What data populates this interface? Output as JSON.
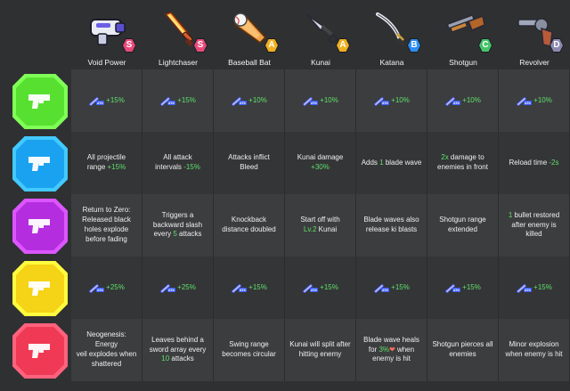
{
  "colors": {
    "background": "#2f3032",
    "highlight_green": "#5fe06a",
    "highlight_red": "#ff6a5a",
    "badge_green": "#57e02f",
    "badge_blue": "#1aa2f0",
    "badge_purple": "#b42ee0",
    "badge_yellow": "#f5d316",
    "badge_red": "#f03a55"
  },
  "weapons": [
    {
      "name": "Void Power",
      "grade": "S",
      "grade_color": "#e84a7a",
      "icon": "void-power-gun-icon"
    },
    {
      "name": "Lightchaser",
      "grade": "S",
      "grade_color": "#e84a7a",
      "icon": "lightchaser-sword-icon"
    },
    {
      "name": "Baseball Bat",
      "grade": "A",
      "grade_color": "#f0b020",
      "icon": "baseball-bat-icon"
    },
    {
      "name": "Kunai",
      "grade": "A",
      "grade_color": "#f0b020",
      "icon": "kunai-icon"
    },
    {
      "name": "Katana",
      "grade": "B",
      "grade_color": "#2c8ef0",
      "icon": "katana-icon"
    },
    {
      "name": "Shotgun",
      "grade": "C",
      "grade_color": "#46c46a",
      "icon": "shotgun-icon"
    },
    {
      "name": "Revolver",
      "grade": "D",
      "grade_color": "#8a8ab0",
      "icon": "revolver-icon"
    }
  ],
  "atk_label": "ATK",
  "rows": [
    {
      "badge_color": "#57e02f",
      "badge_icon": "gun-icon",
      "cells": [
        {
          "type": "atk",
          "value": "+15%"
        },
        {
          "type": "atk",
          "value": "+15%"
        },
        {
          "type": "atk",
          "value": "+10%"
        },
        {
          "type": "atk",
          "value": "+10%"
        },
        {
          "type": "atk",
          "value": "+10%"
        },
        {
          "type": "atk",
          "value": "+10%"
        },
        {
          "type": "atk",
          "value": "+10%"
        }
      ]
    },
    {
      "badge_color": "#1aa2f0",
      "badge_icon": "gun-icon",
      "cells": [
        {
          "type": "text",
          "parts": [
            {
              "t": "All projectile\nrange "
            },
            {
              "t": "+15%",
              "c": "green"
            }
          ]
        },
        {
          "type": "text",
          "parts": [
            {
              "t": "All attack\nintervals "
            },
            {
              "t": "-15%",
              "c": "green"
            }
          ]
        },
        {
          "type": "text",
          "parts": [
            {
              "t": "Attacks inflict\nBleed"
            }
          ]
        },
        {
          "type": "text",
          "parts": [
            {
              "t": "Kunai damage\n"
            },
            {
              "t": "+30%",
              "c": "green"
            }
          ]
        },
        {
          "type": "text",
          "parts": [
            {
              "t": "Adds "
            },
            {
              "t": "1",
              "c": "green"
            },
            {
              "t": " blade wave"
            }
          ]
        },
        {
          "type": "text",
          "parts": [
            {
              "t": "2x",
              "c": "green"
            },
            {
              "t": " damage to\nenemies in front"
            }
          ]
        },
        {
          "type": "text",
          "parts": [
            {
              "t": "Reload time "
            },
            {
              "t": "-2s",
              "c": "green"
            }
          ]
        }
      ]
    },
    {
      "badge_color": "#b42ee0",
      "badge_icon": "gun-icon",
      "cells": [
        {
          "type": "text",
          "parts": [
            {
              "t": "Return to Zero:\nReleased black\nholes explode\nbefore fading"
            }
          ]
        },
        {
          "type": "text",
          "parts": [
            {
              "t": "Triggers a\nbackward slash\nevery "
            },
            {
              "t": "5",
              "c": "green"
            },
            {
              "t": " attacks"
            }
          ]
        },
        {
          "type": "text",
          "parts": [
            {
              "t": "Knockback\ndistance doubled"
            }
          ]
        },
        {
          "type": "text",
          "parts": [
            {
              "t": "Start off with\n"
            },
            {
              "t": "Lv.2",
              "c": "green"
            },
            {
              "t": " Kunai"
            }
          ]
        },
        {
          "type": "text",
          "parts": [
            {
              "t": "Blade waves also\nrelease ki blasts"
            }
          ]
        },
        {
          "type": "text",
          "parts": [
            {
              "t": "Shotgun range\nextended"
            }
          ]
        },
        {
          "type": "text",
          "parts": [
            {
              "t": "1",
              "c": "green"
            },
            {
              "t": " bullet restored\nafter enemy is killed"
            }
          ]
        }
      ]
    },
    {
      "badge_color": "#f5d316",
      "badge_icon": "gun-icon",
      "cells": [
        {
          "type": "atk",
          "value": "+25%"
        },
        {
          "type": "atk",
          "value": "+25%"
        },
        {
          "type": "atk",
          "value": "+15%"
        },
        {
          "type": "atk",
          "value": "+15%"
        },
        {
          "type": "atk",
          "value": "+15%"
        },
        {
          "type": "atk",
          "value": "+15%"
        },
        {
          "type": "atk",
          "value": "+15%"
        }
      ]
    },
    {
      "badge_color": "#f03a55",
      "badge_icon": "gun-icon",
      "cells": [
        {
          "type": "text",
          "parts": [
            {
              "t": "Neogenesis: Energy\nveil explodes when\nshattered"
            }
          ]
        },
        {
          "type": "text",
          "parts": [
            {
              "t": "Leaves behind a\nsword array every\n"
            },
            {
              "t": "10",
              "c": "green"
            },
            {
              "t": " attacks"
            }
          ]
        },
        {
          "type": "text",
          "parts": [
            {
              "t": "Swing range\nbecomes circular"
            }
          ]
        },
        {
          "type": "text",
          "parts": [
            {
              "t": "Kunai will split after\nhitting enemy"
            }
          ]
        },
        {
          "type": "text",
          "parts": [
            {
              "t": "Blade wave heals\nfor "
            },
            {
              "t": "3%",
              "c": "green"
            },
            {
              "t": "❤",
              "c": "red"
            },
            {
              "t": " when\nenemy is hit"
            }
          ]
        },
        {
          "type": "text",
          "parts": [
            {
              "t": "Shotgun pierces all\nenemies"
            }
          ]
        },
        {
          "type": "text",
          "parts": [
            {
              "t": "Minor explosion\nwhen enemy is hit"
            }
          ]
        }
      ]
    }
  ]
}
